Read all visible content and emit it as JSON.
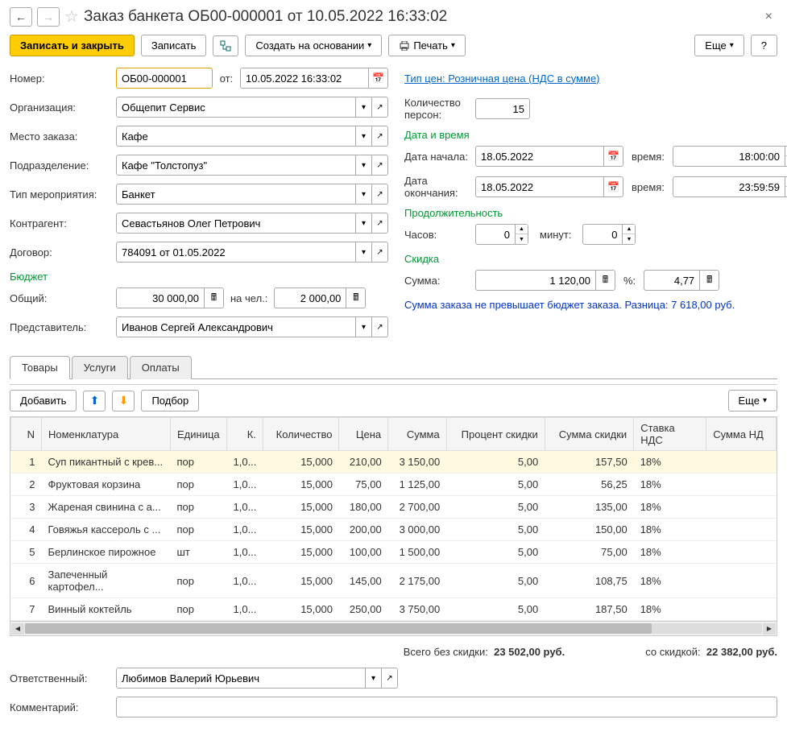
{
  "header": {
    "title": "Заказ банкета ОБ00-000001 от 10.05.2022 16:33:02"
  },
  "toolbar": {
    "save_close": "Записать и закрыть",
    "save": "Записать",
    "create_based": "Создать на основании",
    "print": "Печать",
    "more": "Еще",
    "help": "?"
  },
  "left": {
    "number_label": "Номер:",
    "number": "ОБ00-000001",
    "from_label": "от:",
    "date": "10.05.2022 16:33:02",
    "org_label": "Организация:",
    "org": "Общепит Сервис",
    "place_label": "Место заказа:",
    "place": "Кафе",
    "dept_label": "Подразделение:",
    "dept": "Кафе \"Толстопуз\"",
    "event_type_label": "Тип мероприятия:",
    "event_type": "Банкет",
    "counterparty_label": "Контрагент:",
    "counterparty": "Севастьянов Олег Петрович",
    "contract_label": "Договор:",
    "contract": "784091 от 01.05.2022",
    "budget_section": "Бюджет",
    "budget_total_label": "Общий:",
    "budget_total": "30 000,00",
    "budget_per_label": "на чел.:",
    "budget_per": "2 000,00",
    "rep_label": "Представитель:",
    "rep": "Иванов Сергей Александрович"
  },
  "right": {
    "price_type_link": "Тип цен: Розничная цена (НДС в сумме)",
    "persons_label": "Количество персон:",
    "persons": "15",
    "datetime_section": "Дата и время",
    "start_date_label": "Дата начала:",
    "start_date": "18.05.2022",
    "start_time_label": "время:",
    "start_time": "18:00:00",
    "end_date_label": "Дата окончания:",
    "end_date": "18.05.2022",
    "end_time_label": "время:",
    "end_time": "23:59:59",
    "duration_section": "Продолжительность",
    "hours_label": "Часов:",
    "hours": "0",
    "minutes_label": "минут:",
    "minutes": "0",
    "discount_section": "Скидка",
    "sum_label": "Сумма:",
    "discount_sum": "1 120,00",
    "pct_label": "%:",
    "discount_pct": "4,77",
    "status": "Сумма заказа не превышает бюджет заказа. Разница: 7 618,00 руб."
  },
  "tabs": {
    "goods": "Товары",
    "services": "Услуги",
    "payments": "Оплаты"
  },
  "table_toolbar": {
    "add": "Добавить",
    "pick": "Подбор",
    "more": "Еще"
  },
  "table": {
    "headers": {
      "n": "N",
      "nom": "Номенклатура",
      "unit": "Единица",
      "k": "К.",
      "qty": "Количество",
      "price": "Цена",
      "sum": "Сумма",
      "disc_pct": "Процент скидки",
      "disc_sum": "Сумма скидки",
      "vat": "Ставка НДС",
      "vat_sum": "Сумма НД"
    },
    "rows": [
      {
        "n": "1",
        "nom": "Суп пикантный с крев...",
        "unit": "пор",
        "k": "1,0...",
        "qty": "15,000",
        "price": "210,00",
        "sum": "3 150,00",
        "disc_pct": "5,00",
        "disc_sum": "157,50",
        "vat": "18%"
      },
      {
        "n": "2",
        "nom": "Фруктовая корзина",
        "unit": "пор",
        "k": "1,0...",
        "qty": "15,000",
        "price": "75,00",
        "sum": "1 125,00",
        "disc_pct": "5,00",
        "disc_sum": "56,25",
        "vat": "18%"
      },
      {
        "n": "3",
        "nom": "Жареная свинина с а...",
        "unit": "пор",
        "k": "1,0...",
        "qty": "15,000",
        "price": "180,00",
        "sum": "2 700,00",
        "disc_pct": "5,00",
        "disc_sum": "135,00",
        "vat": "18%"
      },
      {
        "n": "4",
        "nom": "Говяжья кассероль с ...",
        "unit": "пор",
        "k": "1,0...",
        "qty": "15,000",
        "price": "200,00",
        "sum": "3 000,00",
        "disc_pct": "5,00",
        "disc_sum": "150,00",
        "vat": "18%"
      },
      {
        "n": "5",
        "nom": "Берлинское пирожное",
        "unit": "шт",
        "k": "1,0...",
        "qty": "15,000",
        "price": "100,00",
        "sum": "1 500,00",
        "disc_pct": "5,00",
        "disc_sum": "75,00",
        "vat": "18%"
      },
      {
        "n": "6",
        "nom": "Запеченный картофел...",
        "unit": "пор",
        "k": "1,0...",
        "qty": "15,000",
        "price": "145,00",
        "sum": "2 175,00",
        "disc_pct": "5,00",
        "disc_sum": "108,75",
        "vat": "18%"
      },
      {
        "n": "7",
        "nom": "Винный коктейль",
        "unit": "пор",
        "k": "1,0...",
        "qty": "15,000",
        "price": "250,00",
        "sum": "3 750,00",
        "disc_pct": "5,00",
        "disc_sum": "187,50",
        "vat": "18%"
      }
    ]
  },
  "totals": {
    "no_discount_label": "Всего без скидки:",
    "no_discount": "23 502,00 руб.",
    "with_discount_label": "со скидкой:",
    "with_discount": "22 382,00 руб."
  },
  "bottom": {
    "responsible_label": "Ответственный:",
    "responsible": "Любимов Валерий Юрьевич",
    "comment_label": "Комментарий:",
    "comment": ""
  }
}
